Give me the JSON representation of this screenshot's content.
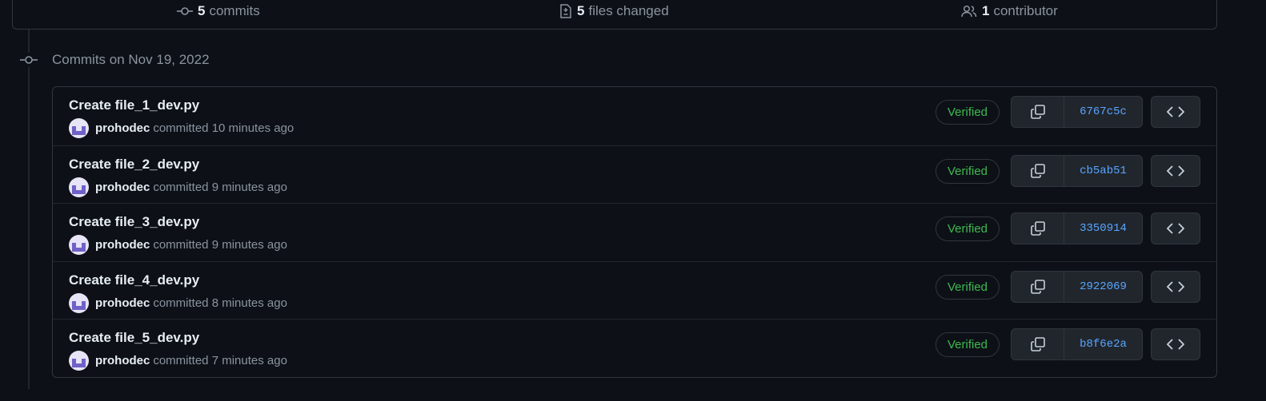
{
  "stats": {
    "commits_count": "5",
    "commits_label": "commits",
    "files_count": "5",
    "files_label": "files changed",
    "contributors_count": "1",
    "contributors_label": "contributor"
  },
  "group": {
    "title": "Commits on Nov 19, 2022"
  },
  "commits": [
    {
      "title": "Create file_1_dev.py",
      "author": "prohodec",
      "meta": "committed 10 minutes ago",
      "badge": "Verified",
      "sha": "6767c5c"
    },
    {
      "title": "Create file_2_dev.py",
      "author": "prohodec",
      "meta": "committed 9 minutes ago",
      "badge": "Verified",
      "sha": "cb5ab51"
    },
    {
      "title": "Create file_3_dev.py",
      "author": "prohodec",
      "meta": "committed 9 minutes ago",
      "badge": "Verified",
      "sha": "3350914"
    },
    {
      "title": "Create file_4_dev.py",
      "author": "prohodec",
      "meta": "committed 8 minutes ago",
      "badge": "Verified",
      "sha": "2922069"
    },
    {
      "title": "Create file_5_dev.py",
      "author": "prohodec",
      "meta": "committed 7 minutes ago",
      "badge": "Verified",
      "sha": "b8f6e2a"
    }
  ],
  "icons": {
    "commit": "git-commit-icon",
    "files": "file-diff-icon",
    "contributors": "people-icon",
    "copy": "copy-icon",
    "browse": "code-icon"
  },
  "colors": {
    "background": "#0d1117",
    "border": "#30363d",
    "verified": "#3fb950",
    "sha_link": "#58a6ff",
    "muted_text": "#8b949e"
  }
}
